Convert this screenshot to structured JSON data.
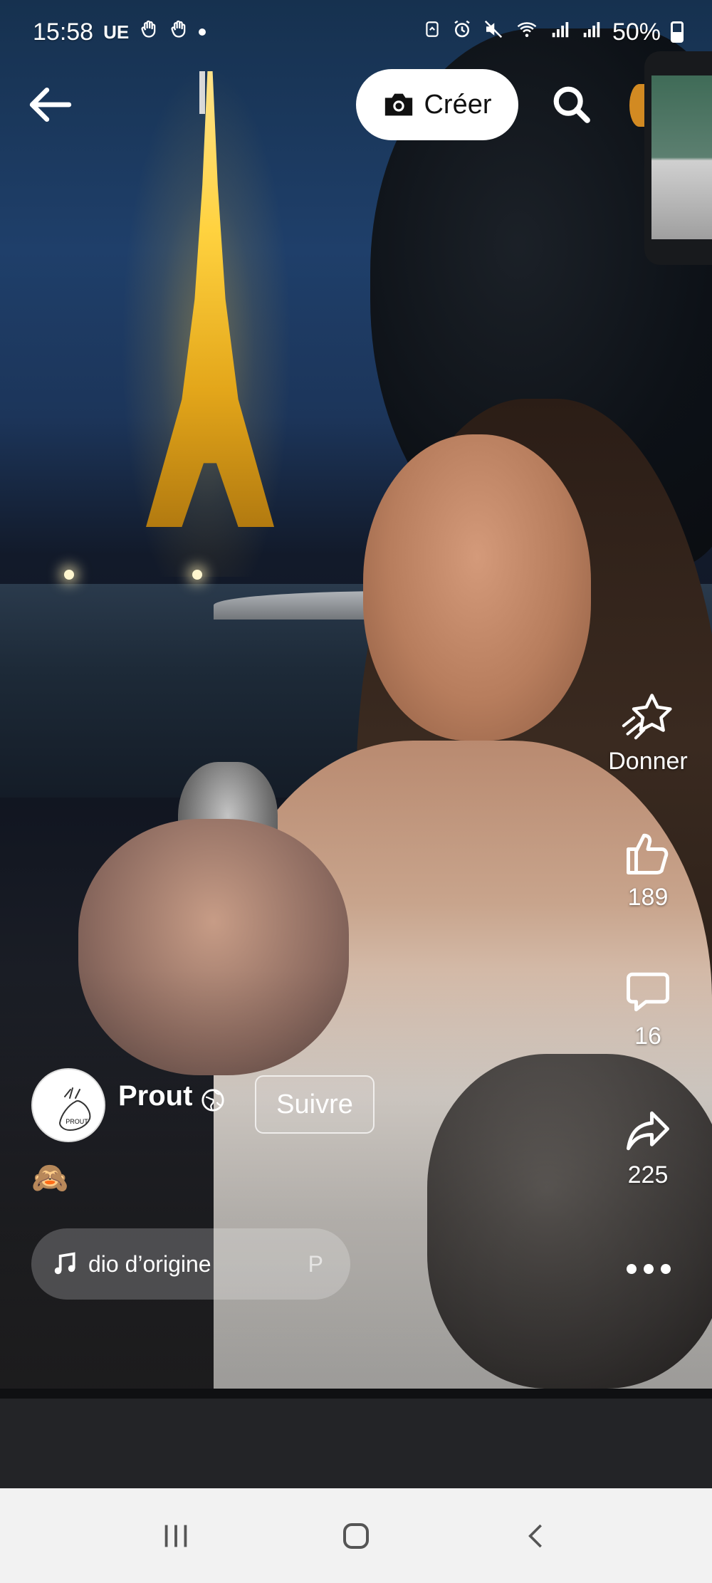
{
  "status": {
    "time": "15:58",
    "region": "UE",
    "battery": "50%"
  },
  "topbar": {
    "create_label": "Créer"
  },
  "actions": {
    "donate_label": "Donner",
    "like_count": "189",
    "comment_count": "16",
    "share_count": "225"
  },
  "author": {
    "name": "Prout",
    "follow_label": "Suivre",
    "avatar_text": "PROUT"
  },
  "caption": {
    "emoji": "🙈"
  },
  "audio": {
    "label": "dio d’origine",
    "extra": "P"
  },
  "icons": {
    "back": "arrow-left-icon",
    "create": "camera-icon",
    "search": "search-icon",
    "donate": "star-icon",
    "like": "thumbs-up-icon",
    "comment": "comment-icon",
    "share": "share-icon",
    "more": "more-icon",
    "audio": "music-note-icon",
    "globe": "globe-icon"
  }
}
